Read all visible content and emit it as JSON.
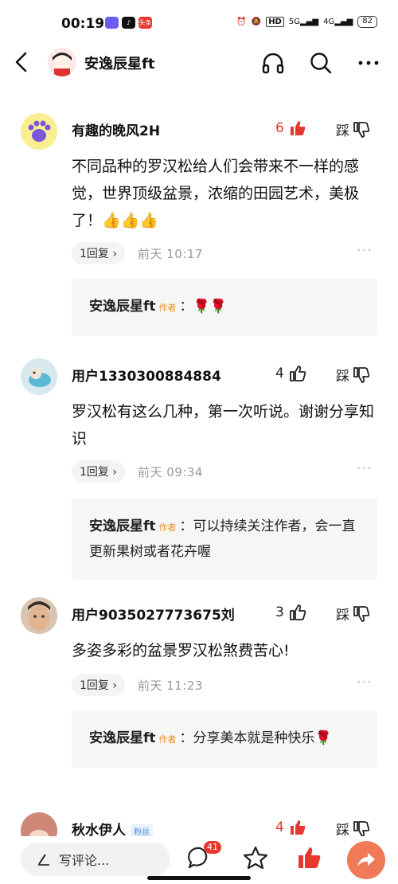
{
  "status_bar": {
    "time": "00:19",
    "app_icons": [
      "app-icon",
      "tiktok-icon",
      "toutiao-icon"
    ],
    "toutiao_text": "头条",
    "hd_label": "HD",
    "net1": "5G",
    "net2": "4G",
    "battery": "82"
  },
  "header": {
    "title": "安逸辰星ft"
  },
  "comments": [
    {
      "user": "有趣的晚风2H",
      "likes": "6",
      "liked": true,
      "tread_label": "踩",
      "text": "不同品种的罗汉松给人们会带来不一样的感觉，世界顶级盆景，浓缩的田园艺术，美极了！👍👍👍",
      "reply_count": "1回复 ›",
      "time": "前天  10:17",
      "reply": {
        "name": "安逸辰星ft",
        "author_tag": "作者",
        "text": "：🌹🌹"
      }
    },
    {
      "user": "用户1330300884884",
      "likes": "4",
      "liked": false,
      "tread_label": "踩",
      "text": "罗汉松有这么几种，第一次听说。谢谢分享知识",
      "reply_count": "1回复 ›",
      "time": "前天  09:34",
      "reply": {
        "name": "安逸辰星ft",
        "author_tag": "作者",
        "text": "：可以持续关注作者，会一直更新果树或者花卉喔"
      }
    },
    {
      "user": "用户9035027773675刘",
      "likes": "3",
      "liked": false,
      "tread_label": "踩",
      "text": "多姿多彩的盆景罗汉松煞费苦心!",
      "reply_count": "1回复 ›",
      "time": "前天  11:23",
      "reply": {
        "name": "安逸辰星ft",
        "author_tag": "作者",
        "text": "：分享美本就是种快乐🌹"
      }
    },
    {
      "user": "秋水伊人",
      "fan_badge": "粉丝",
      "likes": "4",
      "liked": true,
      "tread_label": "踩"
    }
  ],
  "bottom_bar": {
    "write_placeholder": "写评论...",
    "comment_count": "41"
  },
  "colors": {
    "accent_red": "#e8372c",
    "author_orange": "#e8921e",
    "share_orange": "#f07a58"
  }
}
